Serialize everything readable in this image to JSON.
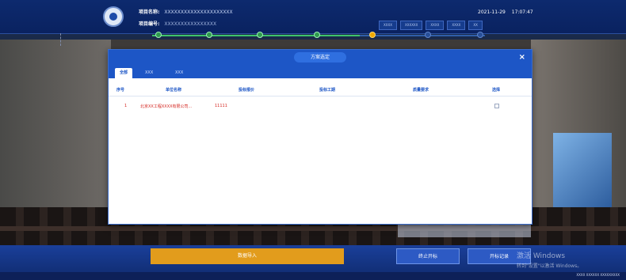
{
  "header": {
    "project_name_label": "项目名称:",
    "project_name_value": "XXXXXXXXXXXXXXXXXXXXX",
    "project_code_label": "项目编号:",
    "project_code_value": "XXXXXXXXXXXXXXXX",
    "date": "2021-11-29",
    "time": "17:07:47",
    "top_buttons": [
      "XXXX",
      "XXXXXX",
      "XXXX",
      "XXXX",
      "XX"
    ]
  },
  "progress": {
    "steps": [
      {
        "label": "",
        "state": "done"
      },
      {
        "label": "",
        "state": "done"
      },
      {
        "label": "",
        "state": "done"
      },
      {
        "label": "",
        "state": "done"
      },
      {
        "label": "",
        "state": "current"
      },
      {
        "label": "",
        "state": "todo"
      },
      {
        "label": "",
        "state": "todo"
      }
    ]
  },
  "modal": {
    "title": "方案选定",
    "close_glyph": "×",
    "tabs": [
      {
        "label": "全部",
        "active": true
      },
      {
        "label": "XXX",
        "active": false
      },
      {
        "label": "XXX",
        "active": false
      }
    ],
    "columns": [
      "序号",
      "单位名称",
      "投标报价",
      "投标工期",
      "质量要求",
      "选择"
    ],
    "rows": [
      {
        "index": "1",
        "company": "北京XX工程XXXX有限公司...",
        "price": "11111",
        "period": "",
        "quality": "",
        "selected": false
      }
    ]
  },
  "bottom": {
    "import_button": "数据导入",
    "stop_button": "终止开标",
    "record_button": "开标记录"
  },
  "watermark": {
    "line1": "激活 Windows",
    "line2": "转到\"设置\"以激活 Windows。"
  },
  "statusbar": {
    "text": "XXXX  XXXXXX  XXXXXXXXX"
  },
  "colors": {
    "primary": "#1d56c6",
    "accent": "#e29c1c",
    "row_text": "#d4241e",
    "progress_done": "#3ec46b"
  }
}
